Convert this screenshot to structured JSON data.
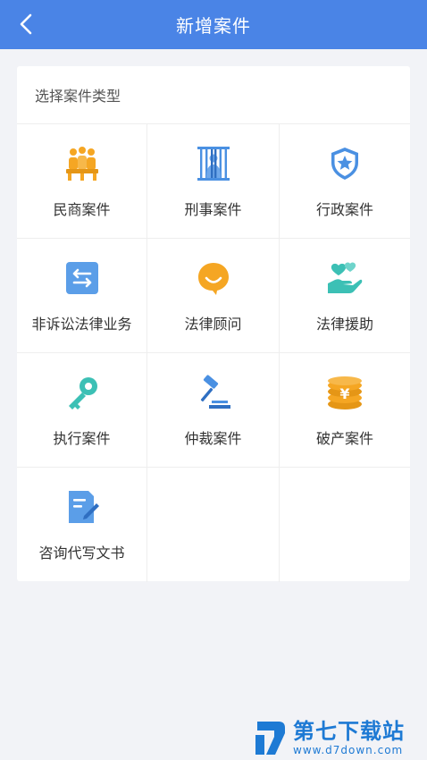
{
  "header": {
    "title": "新增案件",
    "back_icon": "chevron-left-icon"
  },
  "section": {
    "title": "选择案件类型",
    "items": [
      {
        "label": "民商案件",
        "icon": "people-group-icon",
        "color": "#f5a623"
      },
      {
        "label": "刑事案件",
        "icon": "prison-bars-icon",
        "color": "#4a90e2"
      },
      {
        "label": "行政案件",
        "icon": "star-shield-icon",
        "color": "#4a90e2"
      },
      {
        "label": "非诉讼法律业务",
        "icon": "exchange-arrows-icon",
        "color": "#4a90e2"
      },
      {
        "label": "法律顾问",
        "icon": "smile-chat-icon",
        "color": "#f5a623"
      },
      {
        "label": "法律援助",
        "icon": "heart-hand-icon",
        "color": "#3cc0b5"
      },
      {
        "label": "执行案件",
        "icon": "key-icon",
        "color": "#3cc0b5"
      },
      {
        "label": "仲裁案件",
        "icon": "gavel-icon",
        "color": "#4a90e2"
      },
      {
        "label": "破产案件",
        "icon": "coin-stack-icon",
        "color": "#f5a623"
      },
      {
        "label": "咨询代写文书",
        "icon": "document-edit-icon",
        "color": "#4a90e2"
      }
    ]
  },
  "watermark": {
    "brand": "第七下载站",
    "url": "www.d7down.com"
  },
  "colors": {
    "header_bg": "#4a84e6",
    "page_bg": "#f2f3f7",
    "card_bg": "#ffffff"
  }
}
